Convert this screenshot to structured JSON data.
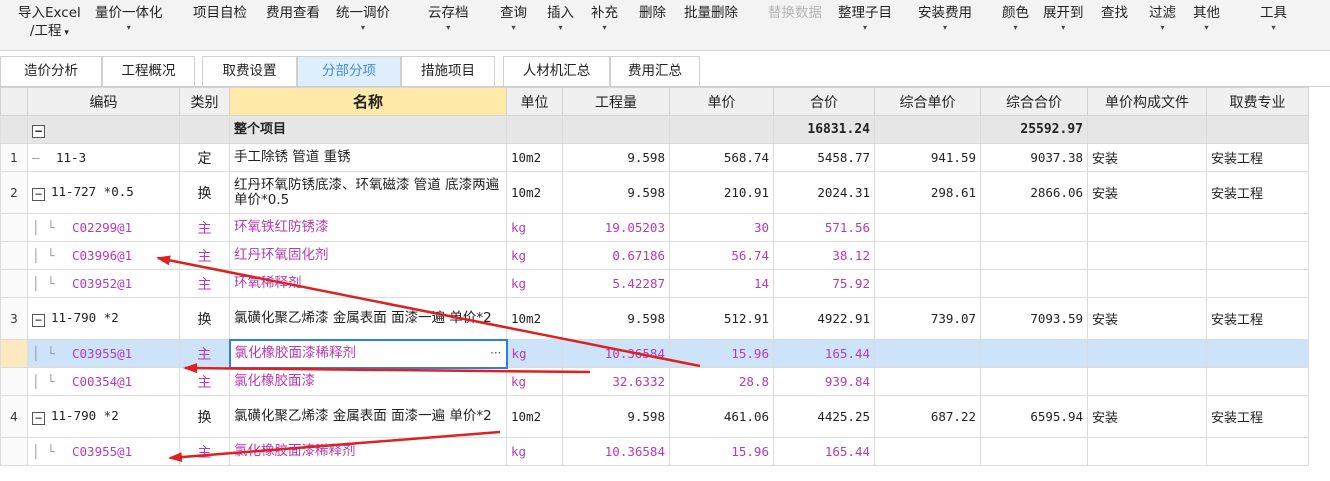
{
  "toolbar": {
    "items": [
      {
        "label": "导入Excel",
        "label2": "/工程",
        "arrow": true
      },
      {
        "label": "量价一体化",
        "arrow": true
      },
      {
        "label": "项目自检",
        "arrow": false
      },
      {
        "label": "费用查看",
        "arrow": false
      },
      {
        "label": "统一调价",
        "arrow": true
      },
      {
        "label": "云存档",
        "arrow": true
      },
      {
        "label": "查询",
        "arrow": true
      },
      {
        "label": "插入",
        "arrow": true
      },
      {
        "label": "补充",
        "arrow": true
      },
      {
        "label": "删除",
        "arrow": false
      },
      {
        "label": "批量删除",
        "arrow": false
      },
      {
        "label": "替换数据",
        "arrow": false,
        "disabled": true
      },
      {
        "label": "整理子目",
        "arrow": true
      },
      {
        "label": "安装费用",
        "arrow": true
      },
      {
        "label": "颜色",
        "arrow": true
      },
      {
        "label": "展开到",
        "arrow": true
      },
      {
        "label": "查找",
        "arrow": false
      },
      {
        "label": "过滤",
        "arrow": true
      },
      {
        "label": "其他",
        "arrow": true
      },
      {
        "label": "工具",
        "arrow": true
      }
    ]
  },
  "tabs": [
    "造价分析",
    "工程概况",
    "取费设置",
    "分部分项",
    "措施项目",
    "人材机汇总",
    "费用汇总"
  ],
  "active_tab": "分部分项",
  "columns": [
    "编码",
    "类别",
    "名称",
    "单位",
    "工程量",
    "单价",
    "合价",
    "综合单价",
    "综合合价",
    "单价构成文件",
    "取费专业"
  ],
  "total_row": {
    "toggle": "−",
    "name": "整个项目",
    "total": "16831.24",
    "comp_total": "25592.97"
  },
  "rows": [
    {
      "rn": "1",
      "code": "11-3",
      "type": "定",
      "name": "手工除锈 管道 重锈",
      "unit": "10m2",
      "qty": "9.598",
      "price": "568.74",
      "total": "5458.77",
      "comp_price": "941.59",
      "comp_total": "9037.38",
      "file": "安装",
      "spec": "安装工程",
      "kind": "main",
      "toggle": ""
    },
    {
      "rn": "2",
      "code": "11-727 *0.5",
      "type": "换",
      "name": "红丹环氧防锈底漆、环氧磁漆 管道 底漆两遍  单价*0.5",
      "unit": "10m2",
      "qty": "9.598",
      "price": "210.91",
      "total": "2024.31",
      "comp_price": "298.61",
      "comp_total": "2866.06",
      "file": "安装",
      "spec": "安装工程",
      "kind": "main",
      "toggle": "−"
    },
    {
      "rn": "",
      "code": "C02299@1",
      "type": "主",
      "name": "环氧铁红防锈漆",
      "unit": "kg",
      "qty": "19.05203",
      "price": "30",
      "total": "571.56",
      "comp_price": "",
      "comp_total": "",
      "file": "",
      "spec": "",
      "kind": "sub"
    },
    {
      "rn": "",
      "code": "C03996@1",
      "type": "主",
      "name": "红丹环氧固化剂",
      "unit": "kg",
      "qty": "0.67186",
      "price": "56.74",
      "total": "38.12",
      "comp_price": "",
      "comp_total": "",
      "file": "",
      "spec": "",
      "kind": "sub"
    },
    {
      "rn": "",
      "code": "C03952@1",
      "type": "主",
      "name": "环氧稀释剂",
      "unit": "kg",
      "qty": "5.42287",
      "price": "14",
      "total": "75.92",
      "comp_price": "",
      "comp_total": "",
      "file": "",
      "spec": "",
      "kind": "sub"
    },
    {
      "rn": "3",
      "code": "11-790 *2",
      "type": "换",
      "name": "氯磺化聚乙烯漆 金属表面 面漆一遍  单价*2",
      "unit": "10m2",
      "qty": "9.598",
      "price": "512.91",
      "total": "4922.91",
      "comp_price": "739.07",
      "comp_total": "7093.59",
      "file": "安装",
      "spec": "安装工程",
      "kind": "main",
      "toggle": "−"
    },
    {
      "rn": "",
      "code": "C03955@1",
      "type": "主",
      "name": "氯化橡胶面漆稀释剂",
      "unit": "kg",
      "qty": "10.36584",
      "price": "15.96",
      "total": "165.44",
      "comp_price": "",
      "comp_total": "",
      "file": "",
      "spec": "",
      "kind": "sub",
      "selected": true
    },
    {
      "rn": "",
      "code": "C00354@1",
      "type": "主",
      "name": "氯化橡胶面漆",
      "unit": "kg",
      "qty": "32.6332",
      "price": "28.8",
      "total": "939.84",
      "comp_price": "",
      "comp_total": "",
      "file": "",
      "spec": "",
      "kind": "sub"
    },
    {
      "rn": "4",
      "code": "11-790 *2",
      "type": "换",
      "name": "氯磺化聚乙烯漆 金属表面 面漆一遍  单价*2",
      "unit": "10m2",
      "qty": "9.598",
      "price": "461.06",
      "total": "4425.25",
      "comp_price": "687.22",
      "comp_total": "6595.94",
      "file": "安装",
      "spec": "安装工程",
      "kind": "main",
      "toggle": "−"
    },
    {
      "rn": "",
      "code": "C03955@1",
      "type": "主",
      "name": "氯化橡胶面漆稀释剂",
      "unit": "kg",
      "qty": "10.36584",
      "price": "15.96",
      "total": "165.44",
      "comp_price": "",
      "comp_total": "",
      "file": "",
      "spec": "",
      "kind": "sub"
    }
  ],
  "colors": {
    "accent": "#3c8fe0",
    "sub_text": "#b53ab5",
    "selection": "#cce3fa",
    "annotation": "#e02020",
    "header_highlight": "#ffe9a8"
  }
}
